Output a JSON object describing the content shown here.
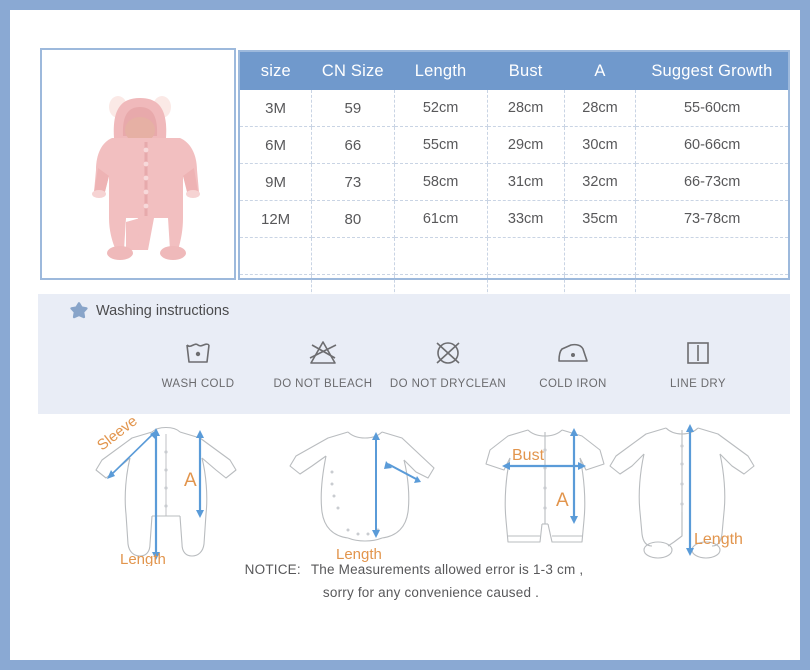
{
  "colors": {
    "page_border": "#8aa9d3",
    "table_header_bg": "#7099cc",
    "table_border": "#9db9dc",
    "wash_band_bg": "#e9edf6",
    "measure_arrow": "#5a9bd8",
    "measure_label": "#e2954d",
    "garment_pink": "#f2bfc0"
  },
  "product_photo": {
    "alt": "pink hooded bear-ear baby romper"
  },
  "size_table": {
    "headers": [
      "size",
      "CN Size",
      "Length",
      "Bust",
      "A",
      "Suggest Growth"
    ],
    "rows": [
      [
        "3M",
        "59",
        "52cm",
        "28cm",
        "28cm",
        "55-60cm"
      ],
      [
        "6M",
        "66",
        "55cm",
        "29cm",
        "30cm",
        "60-66cm"
      ],
      [
        "9M",
        "73",
        "58cm",
        "31cm",
        "32cm",
        "66-73cm"
      ],
      [
        "12M",
        "80",
        "61cm",
        "33cm",
        "35cm",
        "73-78cm"
      ],
      [
        "",
        "",
        "",
        "",
        "",
        ""
      ],
      [
        "",
        "",
        "",
        "",
        "",
        ""
      ]
    ]
  },
  "washing": {
    "title": "Washing instructions",
    "star_icon": "star-icon",
    "items": [
      {
        "label": "WASH COLD",
        "icon": "wash-cold-icon"
      },
      {
        "label": "DO NOT BLEACH",
        "icon": "do-not-bleach-icon"
      },
      {
        "label": "DO NOT DRYCLEAN",
        "icon": "do-not-dryclean-icon"
      },
      {
        "label": "COLD IRON",
        "icon": "cold-iron-icon"
      },
      {
        "label": "LINE DRY",
        "icon": "line-dry-icon"
      }
    ]
  },
  "diagrams": [
    {
      "name": "long-sleeve-footless-romper",
      "labels": [
        "Sleeve",
        "A",
        "Length"
      ]
    },
    {
      "name": "long-sleeve-bodysuit",
      "labels": [
        "Length"
      ]
    },
    {
      "name": "short-sleeve-romper",
      "labels": [
        "Bust",
        "A"
      ]
    },
    {
      "name": "long-sleeve-footed-romper",
      "labels": [
        "Length"
      ]
    }
  ],
  "notice": {
    "label": "NOTICE:",
    "line1": "The Measurements allowed error is 1-3 cm ,",
    "line2": "sorry for any convenience caused ."
  }
}
